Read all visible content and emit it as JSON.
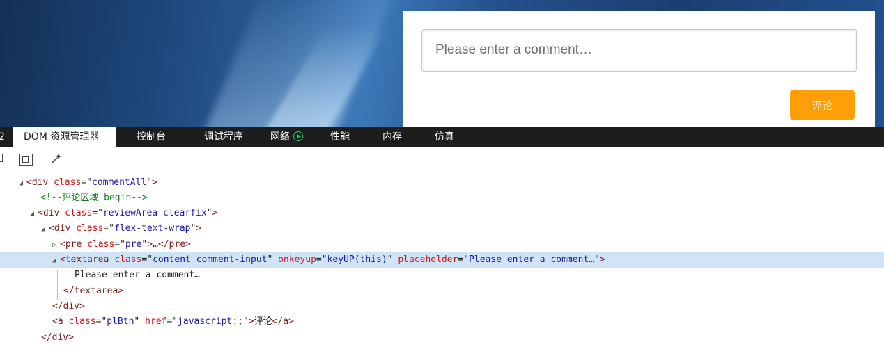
{
  "preview": {
    "comment_placeholder": "Please enter a comment…",
    "submit_label": "评论",
    "accent_color": "#ff9f08"
  },
  "devtools": {
    "tabs": {
      "partial": "2",
      "dom_explorer": "DOM 资源管理器",
      "console": "控制台",
      "debugger": "调试程序",
      "network": "网络",
      "performance": "性能",
      "memory": "内存",
      "emulation": "仿真"
    },
    "active_tab": "DOM 资源管理器",
    "toolbar_icons": [
      "select-element-icon",
      "box-model-icon",
      "eyedropper-icon"
    ]
  },
  "dom": {
    "r1": {
      "tag": "div",
      "attr": "class",
      "val": "commentAll"
    },
    "r2": {
      "comment": "<!--评论区域 begin-->"
    },
    "r3": {
      "tag": "div",
      "attr": "class",
      "val": "reviewArea clearfix"
    },
    "r4": {
      "tag": "div",
      "attr": "class",
      "val": "flex-text-wrap"
    },
    "r5": {
      "tag": "pre",
      "attr": "class",
      "val": "pre",
      "ellipsis": "…",
      "close": "</pre>"
    },
    "r6": {
      "tag": "textarea",
      "a1": "class",
      "v1": "content comment-input",
      "a2": "onkeyup",
      "v2": "keyUP(this)",
      "a3": "placeholder",
      "v3": "Please enter a comment…"
    },
    "r7": {
      "text": "Please enter a comment…"
    },
    "r8": {
      "close": "</textarea>"
    },
    "r9": {
      "close": "</div>"
    },
    "r10": {
      "tag": "a",
      "a1": "class",
      "v1": "plBtn",
      "a2": "href",
      "v2": "javascript:;",
      "text": "评论",
      "close": "</a>"
    },
    "r11": {
      "close": "</div>"
    }
  }
}
